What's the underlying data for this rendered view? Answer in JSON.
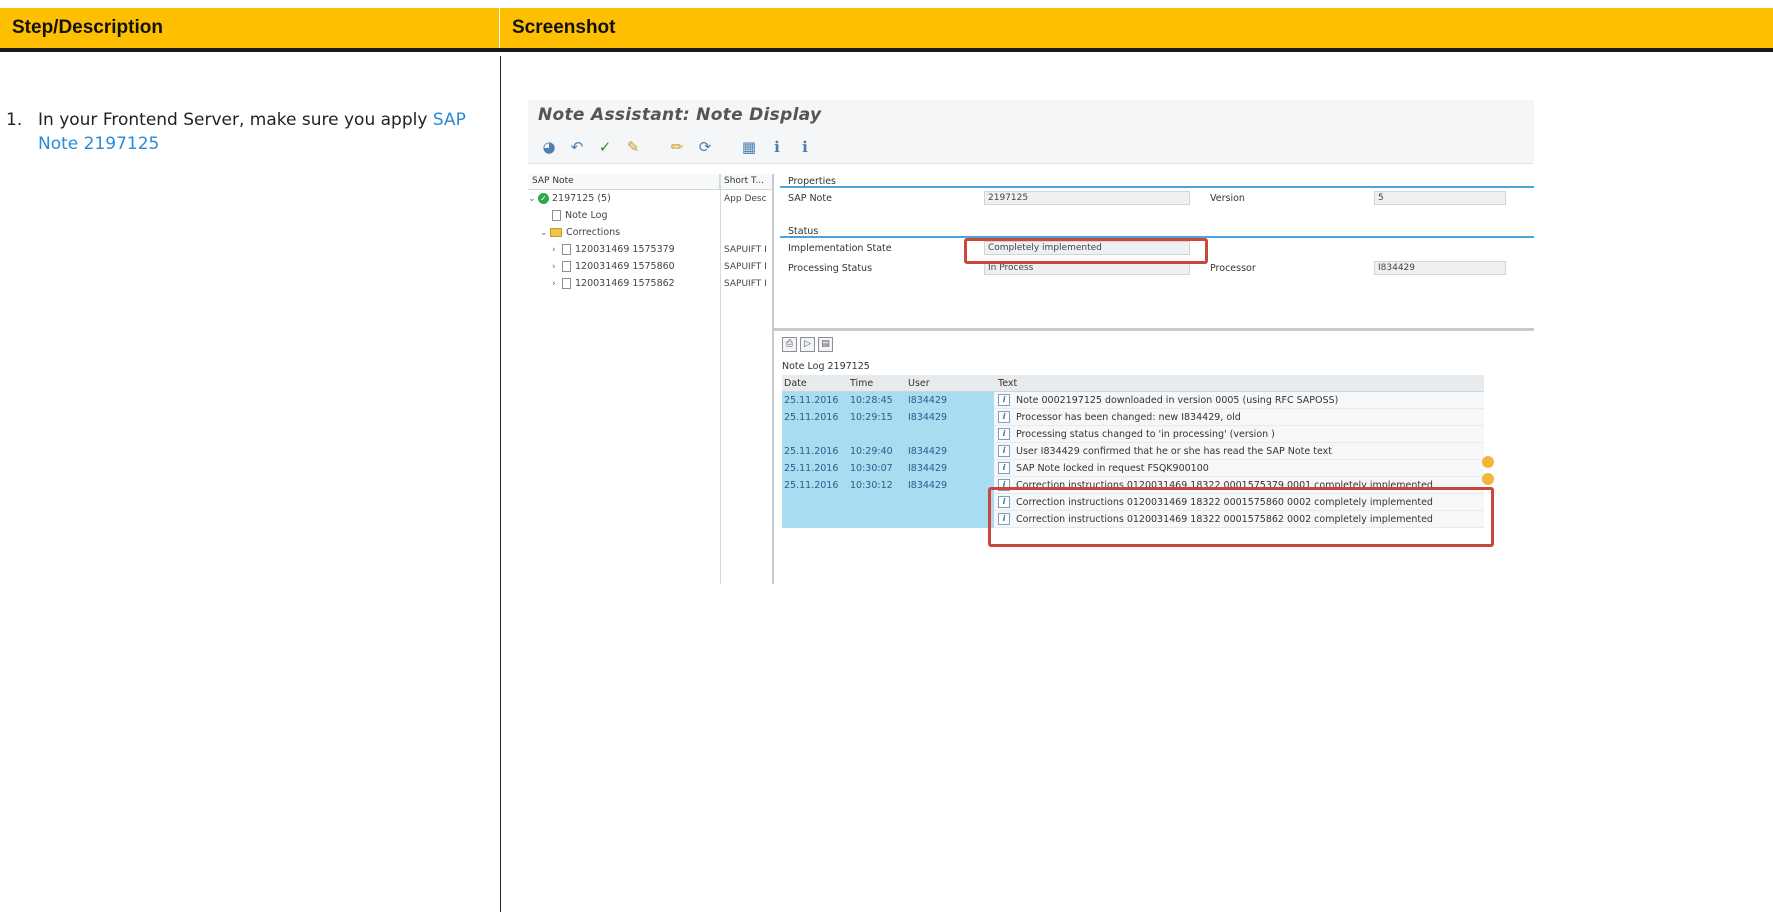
{
  "table": {
    "header_step": "Step/Description",
    "header_screenshot": "Screenshot"
  },
  "step": {
    "number": "1.",
    "text": "In your Frontend Server, make sure you apply ",
    "link": "SAP Note 2197125"
  },
  "sap": {
    "title": "Note Assistant: Note Display",
    "toolbar_icons": [
      "execute-icon",
      "undo-icon",
      "check-icon",
      "assign-icon",
      "edit-icon",
      "refresh-icon",
      "layout-icon",
      "info-icon",
      "info-icon"
    ],
    "tree": {
      "col1": "SAP Note",
      "col2": "Short T...",
      "root": "2197125 (5)",
      "root_short": "App Desc",
      "note_log": "Note Log",
      "corrections": "Corrections",
      "items": [
        {
          "label": "120031469 1575379",
          "short": "SAPUIFT I"
        },
        {
          "label": "120031469 1575860",
          "short": "SAPUIFT I"
        },
        {
          "label": "120031469 1575862",
          "short": "SAPUIFT I"
        }
      ]
    },
    "properties": {
      "section": "Properties",
      "sap_note_label": "SAP Note",
      "sap_note_value": "2197125",
      "version_label": "Version",
      "version_value": "5"
    },
    "status": {
      "section": "Status",
      "impl_label": "Implementation State",
      "impl_value": "Completely implemented",
      "proc_label": "Processing Status",
      "proc_value": "In Process",
      "processor_label": "Processor",
      "processor_value": "I834429"
    },
    "log": {
      "caption": "Note Log 2197125",
      "columns": [
        "Date",
        "Time",
        "User",
        "Text"
      ],
      "rows": [
        {
          "date": "25.11.2016",
          "time": "10:28:45",
          "user": "I834429",
          "text": "Note 0002197125 downloaded in version 0005 (using RFC SAPOSS)"
        },
        {
          "date": "25.11.2016",
          "time": "10:29:15",
          "user": "I834429",
          "text": "Processor has been changed: new I834429, old"
        },
        {
          "date": "",
          "time": "",
          "user": "",
          "text": "Processing status changed to 'in processing' (version )"
        },
        {
          "date": "25.11.2016",
          "time": "10:29:40",
          "user": "I834429",
          "text": "User I834429 confirmed that he or she has read the SAP Note text"
        },
        {
          "date": "25.11.2016",
          "time": "10:30:07",
          "user": "I834429",
          "text": "SAP Note locked in request FSQK900100"
        },
        {
          "date": "25.11.2016",
          "time": "10:30:12",
          "user": "I834429",
          "text": "Correction instructions 0120031469 18322 0001575379 0001 completely implemented"
        },
        {
          "date": "",
          "time": "",
          "user": "",
          "text": "Correction instructions 0120031469 18322 0001575860 0002 completely implemented"
        },
        {
          "date": "",
          "time": "",
          "user": "",
          "text": "Correction instructions 0120031469 18322 0001575862 0002 completely implemented"
        }
      ]
    },
    "colors": {
      "header_yellow": "#fdbf00",
      "link_blue": "#2a8bd6",
      "highlight_red": "#c9473c",
      "log_cell_blue": "#a8dcf0"
    }
  }
}
